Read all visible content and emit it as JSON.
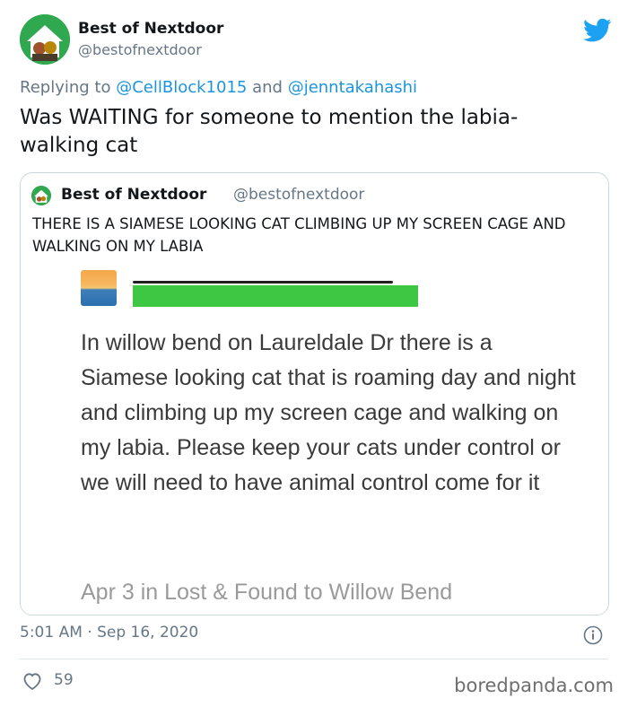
{
  "tweet": {
    "display_name": "Best of Nextdoor",
    "handle": "@bestofnextdoor",
    "replying_prefix": "Replying to",
    "replying_mention_1": "@CellBlock1015",
    "replying_and": "and",
    "replying_mention_2": "@jenntakahashi",
    "text": "Was WAITING for someone to mention the labia-walking cat",
    "timestamp": "5:01 AM · Sep 16, 2020",
    "likes": "59"
  },
  "quote": {
    "display_name": "Best of Nextdoor",
    "handle": "@bestofnextdoor",
    "text": "THERE IS A SIAMESE LOOKING CAT CLIMBING UP MY SCREEN CAGE AND WALKING ON MY LABIA",
    "post_text": "In willow bend on Laureldale Dr there is a Siamese looking cat that is roaming day and night and climbing up my screen cage and walking on my labia. Please keep your cats under control or we will need to have animal control come for it",
    "post_meta": "Apr 3 in Lost & Found to Willow Bend"
  },
  "watermark": "boredpanda.com",
  "icons": {
    "brand": "twitter-bird-icon",
    "info": "info-icon",
    "like": "heart-icon"
  },
  "colors": {
    "twitter_blue": "#1da1f2",
    "link": "#1b95e0",
    "muted": "#657786",
    "censor_green": "#3ec742"
  }
}
